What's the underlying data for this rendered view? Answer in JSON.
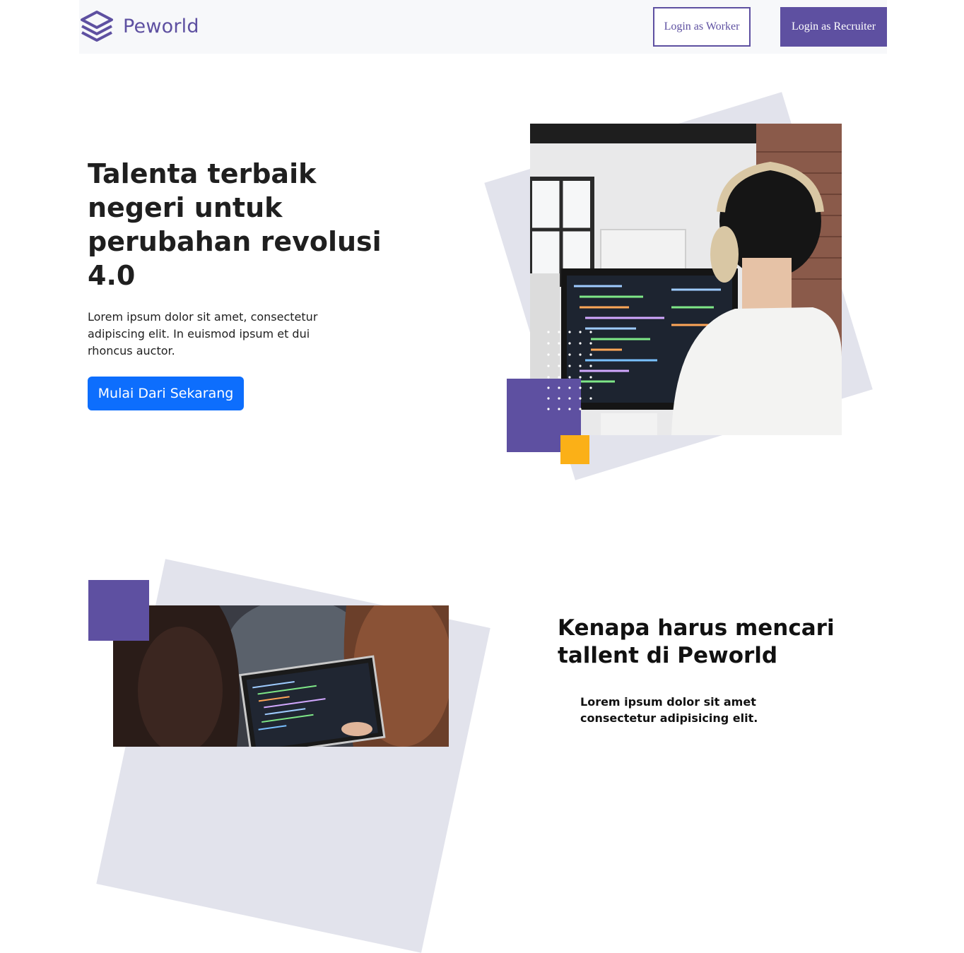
{
  "brand": {
    "name": "Peworld",
    "color": "#5e50a1",
    "icon": "layers-icon"
  },
  "nav": {
    "login_worker_label": "Login as Worker",
    "login_recruiter_label": "Login as Recruiter"
  },
  "hero": {
    "title": "Talenta terbaik negeri untuk perubahan revolusi 4.0",
    "description": "Lorem ipsum dolor sit amet, consectetur adipiscing elit. In euismod ipsum et dui rhoncus auctor.",
    "cta_label": "Mulai Dari Sekarang",
    "cta_color": "#0d6efd"
  },
  "why": {
    "title": "Kenapa harus mencari tallent di Peworld",
    "first_item": "Lorem ipsum dolor sit amet consectetur adipisicing elit."
  },
  "colors": {
    "accent_purple": "#5e50a1",
    "accent_yellow": "#fbb017",
    "shape_grey": "#e2e3ec"
  }
}
